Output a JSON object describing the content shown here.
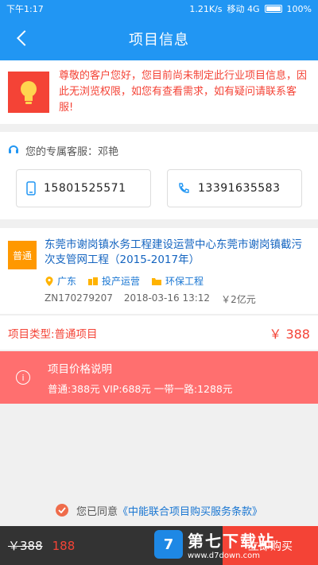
{
  "status_bar": {
    "time": "下午1:17",
    "speed": "1.21K/s",
    "carrier": "移动 4G",
    "battery": "100%"
  },
  "nav": {
    "title": "项目信息"
  },
  "notice": {
    "text": "尊敬的客户您好，您目前尚未制定此行业项目信息，因此无浏览权限，如您有查看需求，如有疑问请联系客服!"
  },
  "agent": {
    "label": "您的专属客服：邓艳",
    "phones": [
      "15801525571",
      "13391635583"
    ]
  },
  "project": {
    "badge": "普通",
    "title": "东莞市谢岗镇水务工程建设运营中心东莞市谢岗镇截污次支管网工程（2015-2017年）",
    "tags": [
      "广东",
      "投产运营",
      "环保工程"
    ],
    "code": "ZN170279207",
    "datetime": "2018-03-16 13:12",
    "amount": "￥2亿元"
  },
  "type_line": {
    "label": "项目类型:普通项目",
    "price": "￥ 388"
  },
  "price_info": {
    "title": "项目价格说明",
    "detail": "普通:388元   VIP:688元   一带一路:1288元"
  },
  "agreement": {
    "prefix": "您已同意",
    "terms": "《中能联合项目购买服务条款》"
  },
  "bottom": {
    "old_price": "￥388",
    "new_price": "188",
    "buy_label": "立即购买"
  },
  "watermark": {
    "name": "第七下载站",
    "url": "www.d7down.com"
  },
  "colors": {
    "primary": "#2196f3",
    "accent": "#f44336",
    "price_bar": "#ff6f6f",
    "badge": "#ff9800"
  }
}
